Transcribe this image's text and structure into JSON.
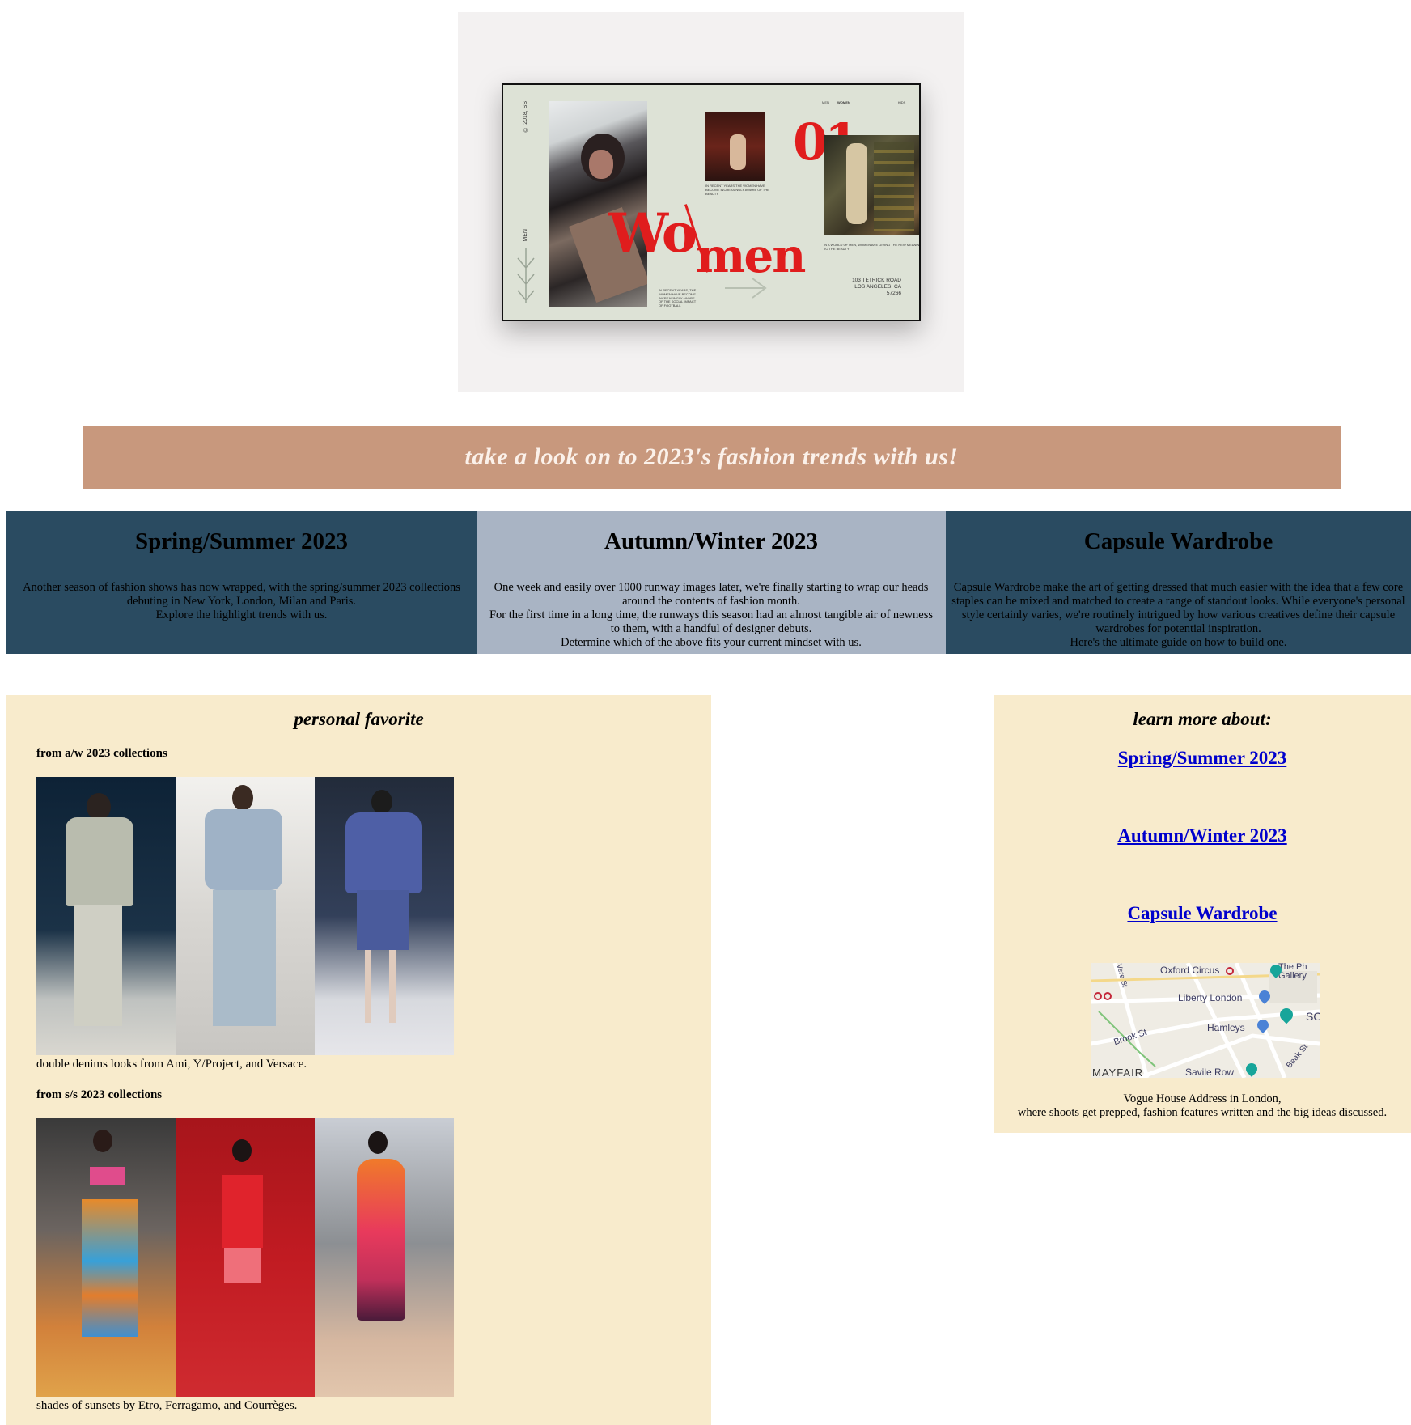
{
  "hero": {
    "copyright": "© 2018, SS",
    "side_label": "MEN",
    "nav": [
      "MEN",
      "WOMEN",
      "KIDS"
    ],
    "number": "01",
    "wordmark_top": "Wo",
    "wordmark_bottom": "men",
    "caption_right": "IN A WORLD OF MEN, WOMEN ARE GIVING THE NEW MEANING TO THE BEAUTY",
    "caption_small": "IN RECENT YEARS THE WOMEN HAVE BECOME INCREASINGLY AWARE OF THE BEAUTY",
    "caption_left": "IN RECENT YEARS, THE WOMEN HAVE BECOME INCREASINGLY AWARE OF THE SOCIAL IMPACT OF FOOTBALL",
    "address_line1": "103 TETRICK ROAD",
    "address_line2": "LOS ANGELES, CA",
    "address_line3": "57266"
  },
  "banner": {
    "text": "take a look on to 2023's fashion trends with us!"
  },
  "columns": [
    {
      "title": "Spring/Summer 2023",
      "lines": [
        "Another season of fashion shows has now wrapped, with the spring/summer 2023 collections",
        "debuting in New York, London, Milan and Paris.",
        "Explore the highlight trends with us."
      ]
    },
    {
      "title": "Autumn/Winter 2023",
      "lines": [
        "One week and easily over 1000 runway images later, we're finally starting to wrap our heads",
        "around the contents of fashion month.",
        "For the first time in a long time, the runways this season had an almost tangible air of newness",
        "to them, with a handful of designer debuts.",
        "Determine which of the above fits your current mindset with us."
      ]
    },
    {
      "title": "Capsule Wardrobe",
      "lines": [
        "Capsule Wardrobe make the art of getting dressed that much easier with the idea that a few core",
        "staples can be mixed and matched to create a range of standout looks. While everyone's personal",
        "style certainly varies, we're routinely intrigued by how various creatives define their capsule",
        "wardrobes for potential inspiration.",
        "Here's the ultimate guide on how to build one."
      ]
    }
  ],
  "favorites": {
    "title": "personal favorite",
    "aw_heading": "from a/w 2023 collections",
    "aw_caption": "double denims looks from Ami, Y/Project, and Versace.",
    "ss_heading": "from s/s 2023 collections",
    "ss_caption": "shades of sunsets by Etro, Ferragamo, and Courrèges."
  },
  "learn": {
    "title": "learn more about:",
    "links": [
      "Spring/Summer 2023",
      "Autumn/Winter 2023",
      "Capsule Wardrobe"
    ],
    "map_labels": {
      "oxford": "Oxford Circus",
      "gallery": "The Ph Gallery",
      "liberty": "Liberty London",
      "hamleys": "Hamleys",
      "brook": "Brook St",
      "mayfair": "MAYFAIR",
      "savile": "Savile Row",
      "beak": "Beak St",
      "vere": "Vere St",
      "soho": "SO"
    },
    "note_line1": "Vogue House Address in London,",
    "note_line2": "where shoots get prepped, fashion features written and the big ideas discussed."
  },
  "colors": {
    "banner_bg": "#c8987d",
    "column_dark": "#2a4b61",
    "column_light": "#a9b4c4",
    "panel_bg": "#f8ebcc",
    "wordmark_red": "#e01d1d",
    "link_blue": "#0000cc"
  }
}
